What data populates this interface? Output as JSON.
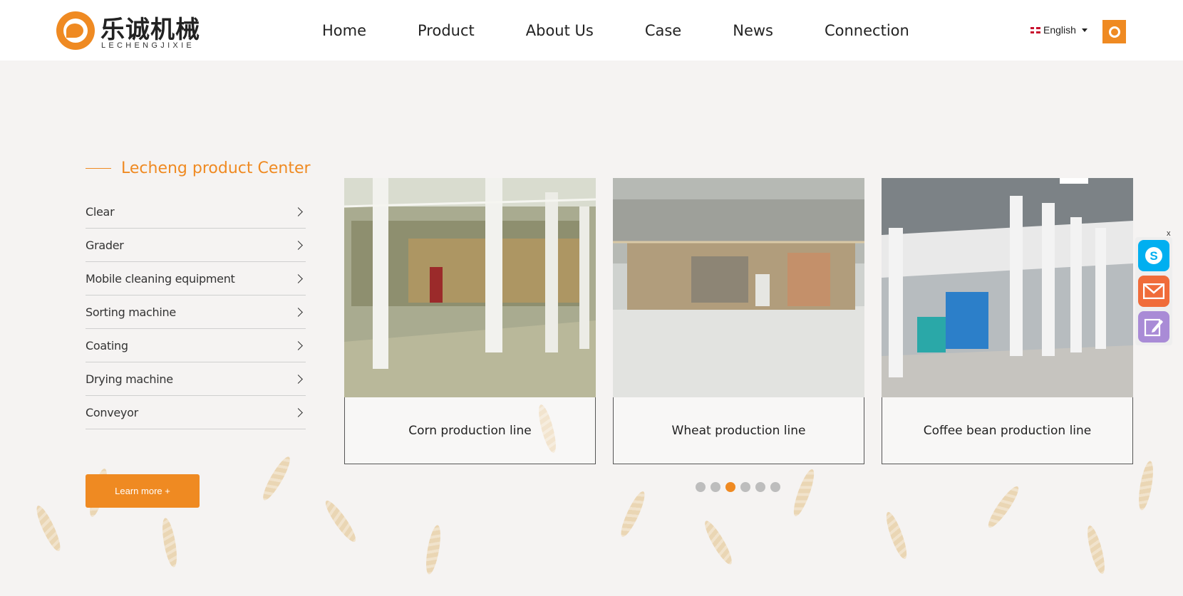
{
  "header": {
    "logo_cn": "乐诚机械",
    "logo_en": "LECHENGJIXIE",
    "nav": [
      {
        "label": "Home"
      },
      {
        "label": "Product"
      },
      {
        "label": "About Us"
      },
      {
        "label": "Case"
      },
      {
        "label": "News"
      },
      {
        "label": "Connection"
      }
    ],
    "language": "English"
  },
  "products": {
    "title": "Lecheng product Center",
    "categories": [
      {
        "label": "Clear"
      },
      {
        "label": "Grader"
      },
      {
        "label": "Mobile cleaning equipment"
      },
      {
        "label": "Sorting machine"
      },
      {
        "label": "Coating"
      },
      {
        "label": "Drying machine"
      },
      {
        "label": "Conveyor"
      }
    ],
    "learn_more": "Learn more +"
  },
  "cases": [
    {
      "caption": "Corn production line"
    },
    {
      "caption": "Wheat production line"
    },
    {
      "caption": "Coffee bean production line"
    }
  ],
  "carousel": {
    "dot_count": 6,
    "active_index": 2
  },
  "floating": {
    "close": "x"
  },
  "colors": {
    "accent": "#ef8a22",
    "skype": "#00aff0",
    "mail": "#f06c3a",
    "edit": "#a98bd6"
  }
}
